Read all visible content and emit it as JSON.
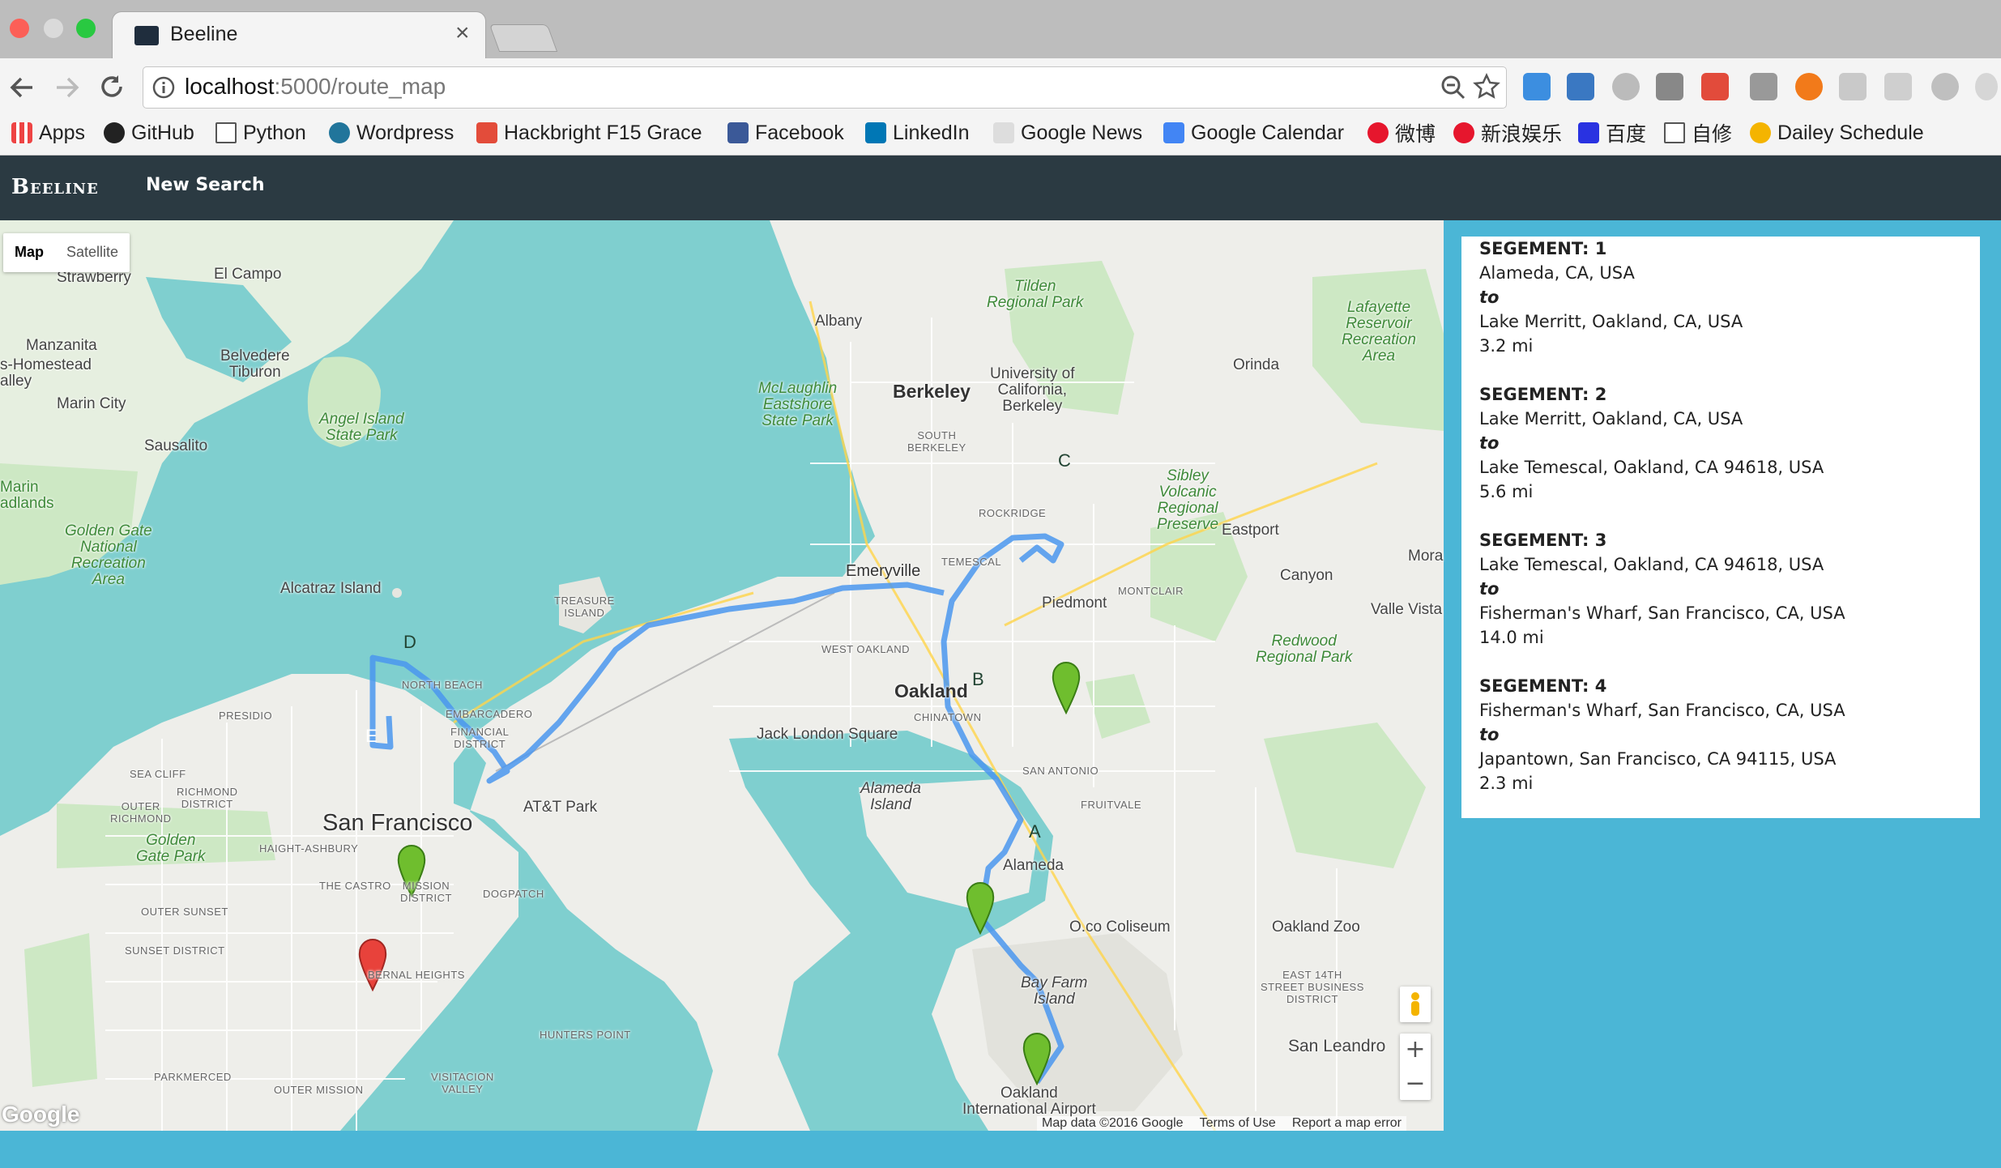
{
  "browser": {
    "tab_title": "Beeline",
    "tab_close": "×",
    "url_host": "localhost",
    "url_path": ":5000/route_map",
    "bookmarks": [
      "Apps",
      "GitHub",
      "Python",
      "Wordpress",
      "Hackbright F15 Grace",
      "Facebook",
      "LinkedIn",
      "Google News",
      "Google Calendar",
      "微博",
      "新浪娱乐",
      "百度",
      "自修",
      "Dailey Schedule"
    ]
  },
  "navbar": {
    "brand": "Beeline",
    "new_search": "New Search"
  },
  "map": {
    "type_buttons": [
      "Map",
      "Satellite"
    ],
    "markers": [
      "A",
      "B",
      "C",
      "D",
      "E"
    ],
    "labels": {
      "strawberry": "Strawberry",
      "el_campo": "El Campo",
      "manzanita": "Manzanita",
      "homestead": "s-Homestead",
      "valley": "alley",
      "belvedere": "Belvedere\nTiburon",
      "marin_city": "Marin City",
      "sausalito": "Sausalito",
      "marin_headlands": "Marin\nadlands",
      "angel_island": "Angel Island\nState Park",
      "golden_gate_nra": "Golden Gate\nNational\nRecreation\nArea",
      "alcatraz": "Alcatraz Island",
      "treasure_island": "TREASURE\nISLAND",
      "albany": "Albany",
      "tilden": "Tilden\nRegional Park",
      "lafayette": "Lafayette\nReservoir\nRecreation\nArea",
      "orinda": "Orinda",
      "mclaughlin": "McLaughlin\nEastshore\nState Park",
      "berkeley": "Berkeley",
      "uc_berkeley": "University of\nCalifornia,\nBerkeley",
      "south_berkeley": "SOUTH\nBERKELEY",
      "rockridge": "ROCKRIDGE",
      "sibley": "Sibley\nVolcanic\nRegional\nPreserve",
      "eastport": "Eastport",
      "temescal": "TEMESCAL",
      "emeryville": "Emeryville",
      "piedmont": "Piedmont",
      "montclair": "MONTCLAIR",
      "canyon": "Canyon",
      "mora": "Mora",
      "valle_vista": "Valle Vista",
      "redwood": "Redwood\nRegional Park",
      "west_oakland": "WEST OAKLAND",
      "oakland": "Oakland",
      "chinatown": "CHINATOWN",
      "jack_london": "Jack London Square",
      "san_antonio": "SAN ANTONIO",
      "fruitvale": "FRUITVALE",
      "alameda_island": "Alameda\nIsland",
      "alameda": "Alameda",
      "coliseum": "O.co Coliseum",
      "oakland_zoo": "Oakland Zoo",
      "bay_farm": "Bay Farm\nIsland",
      "east_14th": "EAST 14TH\nSTREET BUSINESS\nDISTRICT",
      "san_leandro": "San Leandro",
      "oakland_airport": "Oakland\nInternational Airport",
      "presidio": "PRESIDIO",
      "north_beach": "NORTH BEACH",
      "embarcadero": "EMBARCADERO",
      "financial": "FINANCIAL\nDISTRICT",
      "sea_cliff": "SEA CLIFF",
      "richmond_district": "RICHMOND\nDISTRICT",
      "outer_richmond": "OUTER\nRICHMOND",
      "san_francisco": "San Francisco",
      "att_park": "AT&T Park",
      "golden_gate_park": "Golden\nGate Park",
      "haight": "HAIGHT-ASHBURY",
      "castro": "THE CASTRO",
      "mission": "MISSION\nDISTRICT",
      "dogpatch": "DOGPATCH",
      "outer_sunset": "OUTER SUNSET",
      "sunset": "SUNSET DISTRICT",
      "bernal": "BERNAL HEIGHTS",
      "hunters_point": "HUNTERS POINT",
      "parkmerced": "PARKMERCED",
      "outer_mission": "OUTER MISSION",
      "visitacion": "VISITACION\nVALLEY"
    },
    "google_logo": "Google",
    "attribution": [
      "Map data ©2016 Google",
      "Terms of Use",
      "Report a map error"
    ],
    "zoom_in": "+",
    "zoom_out": "−"
  },
  "segments": [
    {
      "title": "SEGEMENT: 1",
      "from": "Alameda, CA, USA",
      "to_label": "to",
      "to": "Lake Merritt, Oakland, CA, USA",
      "distance": "3.2 mi"
    },
    {
      "title": "SEGEMENT: 2",
      "from": "Lake Merritt, Oakland, CA, USA",
      "to_label": "to",
      "to": "Lake Temescal, Oakland, CA 94618, USA",
      "distance": "5.6 mi"
    },
    {
      "title": "SEGEMENT: 3",
      "from": "Lake Temescal, Oakland, CA 94618, USA",
      "to_label": "to",
      "to": "Fisherman's Wharf, San Francisco, CA, USA",
      "distance": "14.0 mi"
    },
    {
      "title": "SEGEMENT: 4",
      "from": "Fisherman's Wharf, San Francisco, CA, USA",
      "to_label": "to",
      "to": "Japantown, San Francisco, CA 94115, USA",
      "distance": "2.3 mi"
    }
  ],
  "colors": {
    "water": "#7fcfcf",
    "land": "#eeeeea",
    "park": "#cde8c4",
    "route": "#5aa8f0",
    "marker_green": "#6fbe2e",
    "marker_red": "#e8423b",
    "navbar": "#2b3a42",
    "page_bg": "#4bb6d6"
  }
}
